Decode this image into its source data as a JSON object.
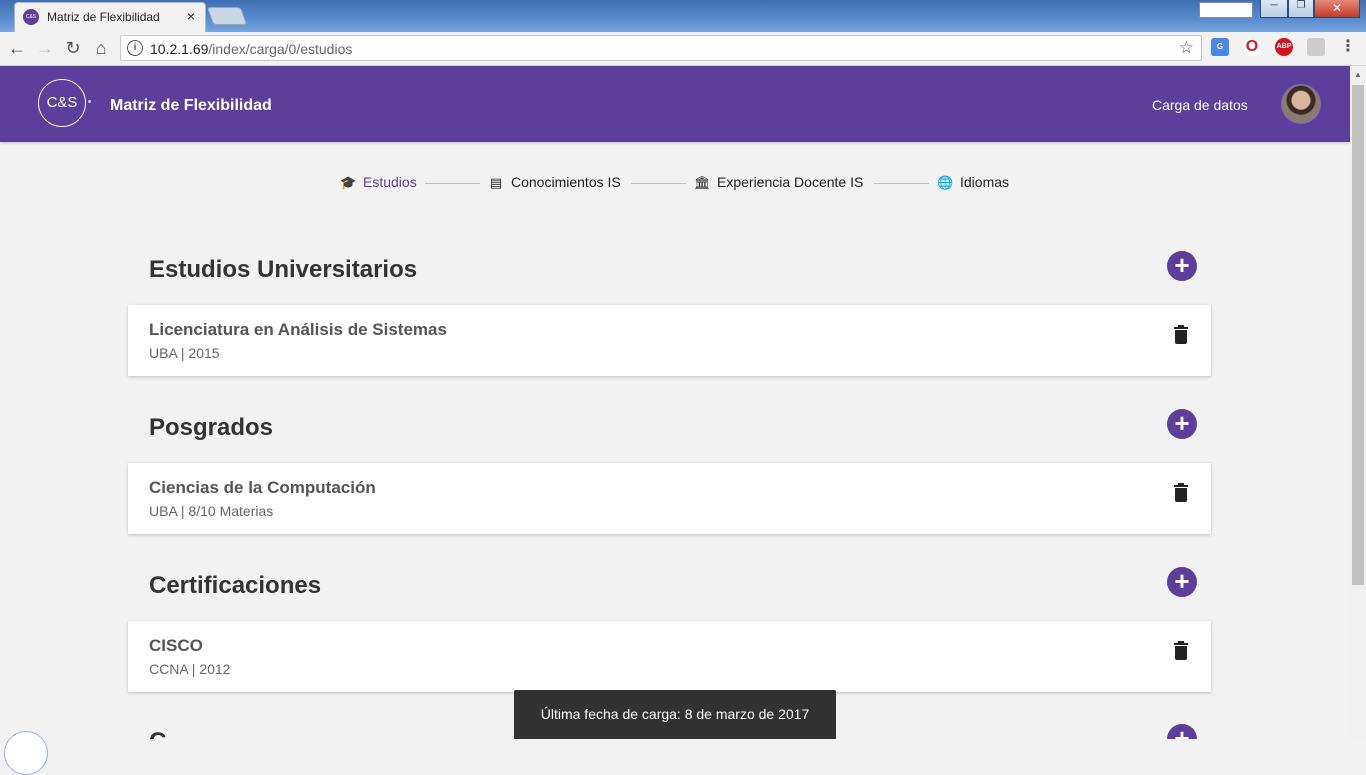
{
  "browser": {
    "tab_title": "Matriz de Flexibilidad",
    "tab_close": "×",
    "favicon_text": "C&S",
    "url_host": "10.2.1.69",
    "url_path": "/index/carga/0/estudios"
  },
  "header": {
    "logo": "C&S",
    "title": "Matriz de Flexibilidad",
    "nav_label": "Carga de datos"
  },
  "stepper": [
    {
      "label": "Estudios",
      "icon": "graduation-cap-icon",
      "active": true
    },
    {
      "label": "Conocimientos IS",
      "icon": "message-icon",
      "active": false
    },
    {
      "label": "Experiencia Docente IS",
      "icon": "institution-icon",
      "active": false
    },
    {
      "label": "Idiomas",
      "icon": "globe-icon",
      "active": false
    }
  ],
  "sections": [
    {
      "title": "Estudios Universitarios",
      "items": [
        {
          "title": "Licenciatura en Análisis de Sistemas",
          "subtitle": "UBA | 2015"
        }
      ]
    },
    {
      "title": "Posgrados",
      "items": [
        {
          "title": "Ciencias de la Computación",
          "subtitle": "UBA | 8/10 Materias"
        }
      ]
    },
    {
      "title": "Certificaciones",
      "items": [
        {
          "title": "CISCO",
          "subtitle": "CCNA | 2012"
        }
      ]
    },
    {
      "title": "C",
      "items": []
    }
  ],
  "snackbar": "Última fecha de carga: 8 de marzo de 2017",
  "colors": {
    "primary": "#5c3f9c",
    "background": "#f2f2f2"
  }
}
